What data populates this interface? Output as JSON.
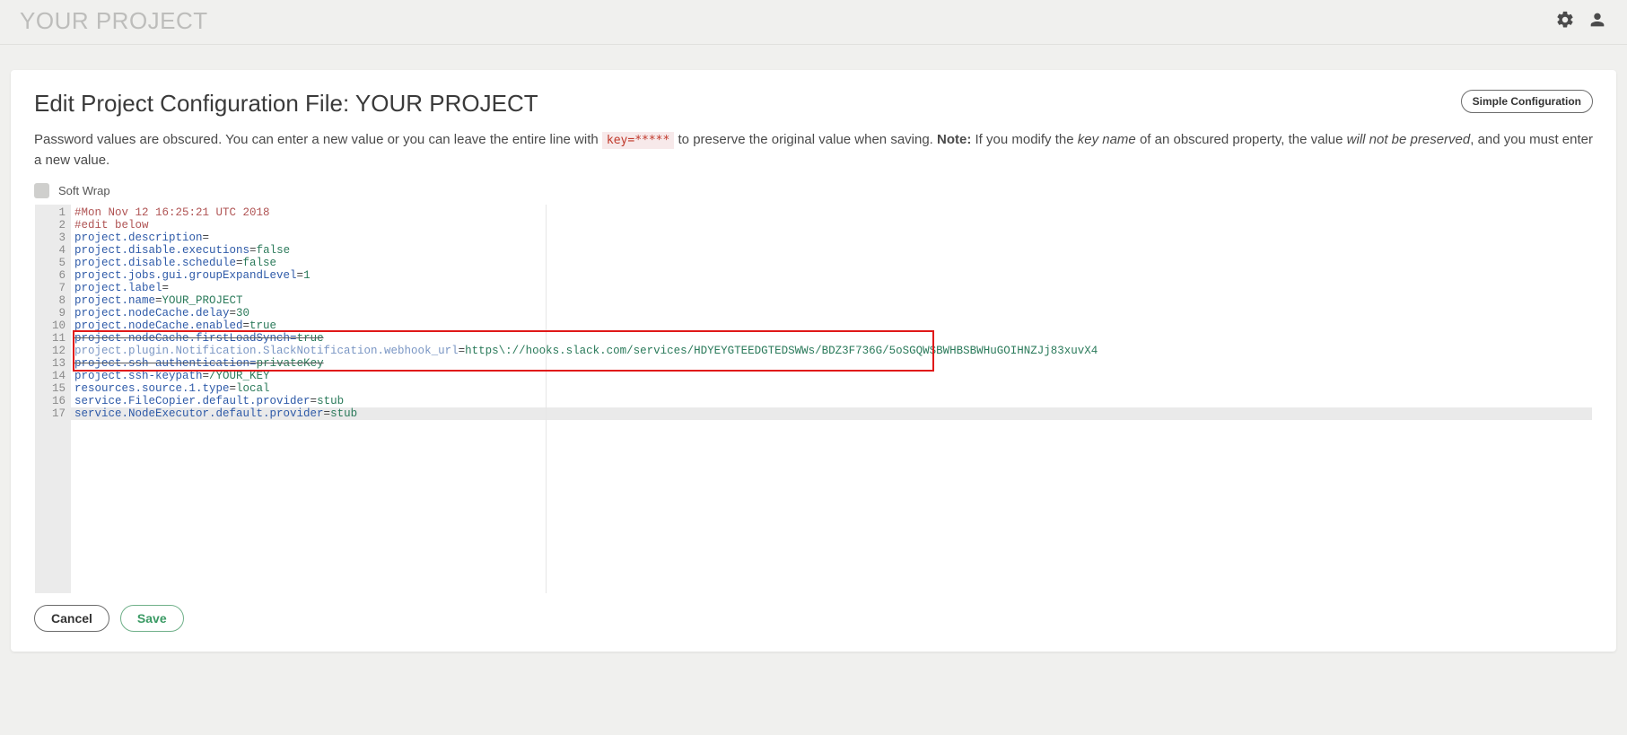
{
  "header": {
    "title": "YOUR PROJECT"
  },
  "page": {
    "title_prefix": "Edit Project Configuration File: ",
    "title_project": "YOUR PROJECT",
    "simple_config_button": "Simple Configuration",
    "help_pre": "Password values are obscured. You can enter a new value or you can leave the entire line with ",
    "help_code": "key=*****",
    "help_mid": " to preserve the original value when saving. ",
    "help_note_label": "Note:",
    "help_post1": " If you modify the ",
    "help_em1": "key name",
    "help_post2": " of an obscured property, the value ",
    "help_em2": "will not be preserved",
    "help_post3": ", and you must enter a new value.",
    "soft_wrap_label": "Soft Wrap"
  },
  "buttons": {
    "cancel": "Cancel",
    "save": "Save"
  },
  "editor": {
    "lines": [
      {
        "n": 1,
        "type": "comment",
        "text": "#Mon Nov 12 16:25:21 UTC 2018"
      },
      {
        "n": 2,
        "type": "comment",
        "text": "#edit below"
      },
      {
        "n": 3,
        "type": "kv",
        "key": "project.description",
        "val": ""
      },
      {
        "n": 4,
        "type": "kv",
        "key": "project.disable.executions",
        "val": "false"
      },
      {
        "n": 5,
        "type": "kv",
        "key": "project.disable.schedule",
        "val": "false"
      },
      {
        "n": 6,
        "type": "kv",
        "key": "project.jobs.gui.groupExpandLevel",
        "val": "1"
      },
      {
        "n": 7,
        "type": "kv",
        "key": "project.label",
        "val": ""
      },
      {
        "n": 8,
        "type": "kv",
        "key": "project.name",
        "val": "YOUR_PROJECT"
      },
      {
        "n": 9,
        "type": "kv",
        "key": "project.nodeCache.delay",
        "val": "30"
      },
      {
        "n": 10,
        "type": "kv",
        "key": "project.nodeCache.enabled",
        "val": "true"
      },
      {
        "n": 11,
        "type": "kv-strike",
        "key": "project.nodeCache.firstLoadSynch",
        "val": "true"
      },
      {
        "n": 12,
        "type": "kv-dim",
        "key": "project.plugin.Notification.SlackNotification.webhook_url",
        "val": "https\\://hooks.slack.com/services/HDYEYGTEEDGTEDSWWs/BDZ3F736G/5oSGQWSBWHBSBWHuGOIHNZJj83xuvX4"
      },
      {
        "n": 13,
        "type": "kv-strike",
        "key": "project.ssh-authentication",
        "val": "privateKey"
      },
      {
        "n": 14,
        "type": "kv",
        "key": "project.ssh-keypath",
        "val": "/YOUR_KEY"
      },
      {
        "n": 15,
        "type": "kv",
        "key": "resources.source.1.type",
        "val": "local"
      },
      {
        "n": 16,
        "type": "kv",
        "key": "service.FileCopier.default.provider",
        "val": "stub"
      },
      {
        "n": 17,
        "type": "kv",
        "key": "service.NodeExecutor.default.provider",
        "val": "stub"
      }
    ]
  },
  "annotation": {
    "highlight_lines_start": 11,
    "highlight_lines_end": 13
  }
}
